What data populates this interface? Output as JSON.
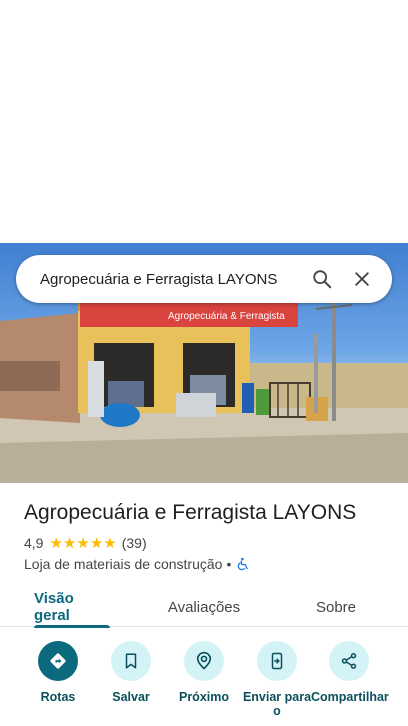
{
  "search": {
    "query": "Agropecuária e Ferragista LAYONS"
  },
  "photo": {
    "sign_text": "Agropecuária & Ferragista"
  },
  "place": {
    "title": "Agropecuária e Ferragista LAYONS",
    "rating": "4,9",
    "stars": 5,
    "review_count": "(39)",
    "category": "Loja de materiais de construção",
    "separator": "•"
  },
  "tabs": [
    {
      "label": "Visão geral",
      "active": true
    },
    {
      "label": "Avaliações",
      "active": false
    },
    {
      "label": "Sobre",
      "active": false
    }
  ],
  "actions": [
    {
      "label": "Rotas",
      "icon": "directions-icon"
    },
    {
      "label": "Salvar",
      "icon": "bookmark-icon"
    },
    {
      "label": "Próximo",
      "icon": "nearby-icon"
    },
    {
      "label": "Enviar para o",
      "icon": "send-to-phone-icon"
    },
    {
      "label": "Compartilhar",
      "icon": "share-icon"
    }
  ],
  "colors": {
    "accent": "#0b6a7d",
    "accent_light": "#d4f3f7",
    "star": "#fbbc04",
    "sign_red": "#d9443f",
    "wall_yellow": "#e9c15a"
  }
}
